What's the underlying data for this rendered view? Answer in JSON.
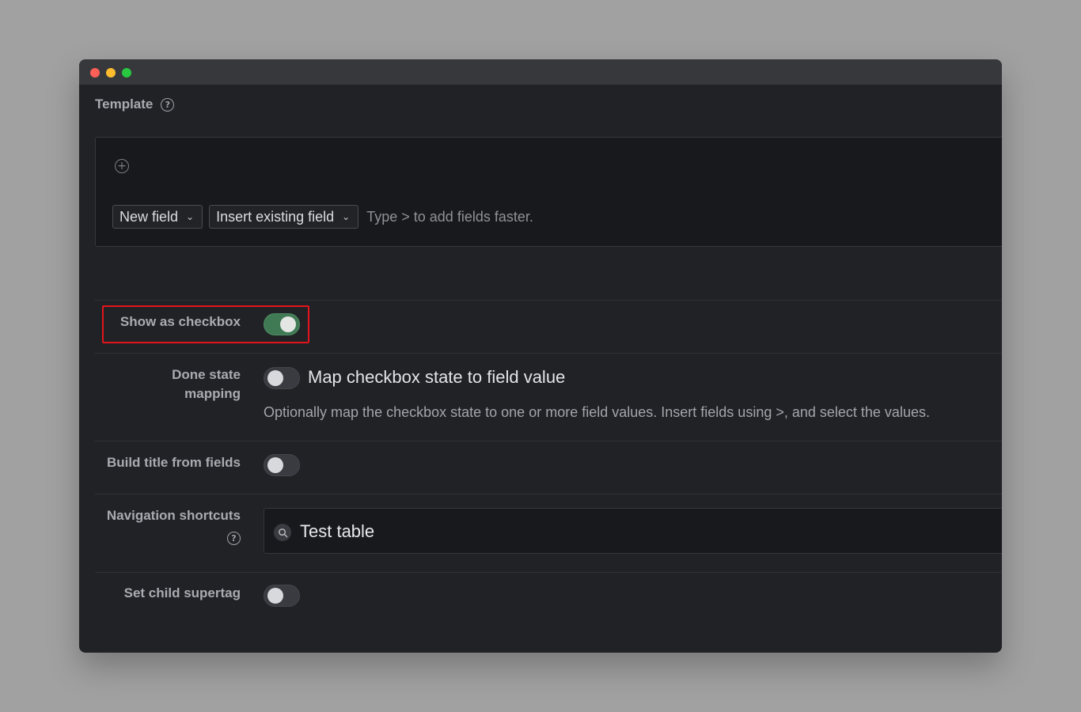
{
  "template": {
    "title": "Template",
    "help_icon": "question-circle-icon",
    "add_icon": "plus-circle-icon",
    "new_field_label": "New field",
    "insert_existing_label": "Insert existing field",
    "hint": "Type > to add fields faster."
  },
  "settings": {
    "show_as_checkbox": {
      "label": "Show as checkbox",
      "enabled": true
    },
    "done_state_mapping": {
      "label_line1": "Done state",
      "label_line2": "mapping",
      "enabled": false,
      "toggle_label": "Map checkbox state to field value",
      "description": "Optionally map the checkbox state to one or more field values. Insert fields using >, and select the values."
    },
    "build_title": {
      "label": "Build title from fields",
      "enabled": false
    },
    "navigation_shortcuts": {
      "label": "Navigation shortcuts",
      "value": "Test table",
      "icon": "search-icon"
    },
    "set_child_supertag": {
      "label": "Set child supertag",
      "enabled": false
    }
  },
  "colors": {
    "toggle_on": "#3f7a54",
    "highlight": "#e3141c"
  }
}
